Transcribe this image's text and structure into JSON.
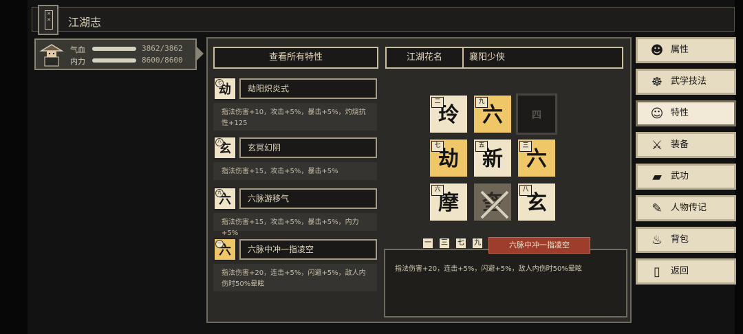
{
  "window": {
    "title": "江湖志"
  },
  "character": {
    "hp_label": "气血",
    "hp_value": "3862/3862",
    "mp_label": "内力",
    "mp_value": "8600/8600"
  },
  "header": {
    "view_all_label": "查看所有特性",
    "nickname_label": "江湖花名",
    "nickname_value": "襄阳少侠"
  },
  "traits": [
    {
      "char": "劫",
      "tier": "七",
      "name": "劫阳炽炎式",
      "desc": "指法伤害+10，攻击+5%，暴击+5%，灼烧抗性+125"
    },
    {
      "char": "玄",
      "tier": "八",
      "name": "玄冥幻阴",
      "desc": "指法伤害+15，攻击+5%，暴击+5%"
    },
    {
      "char": "六",
      "tier": "九",
      "name": "六脉游移气",
      "desc": "指法伤害+15，攻击+5%，暴击+5%，内力+5%"
    },
    {
      "char": "六",
      "tier": "一",
      "name": "六脉中冲一指凌空",
      "desc": "指法伤害+20，连击+5%，闪避+5%，敌人内伤时50%晕眩"
    }
  ],
  "grid": [
    {
      "char": "玲",
      "num": "二",
      "style": "light"
    },
    {
      "char": "六",
      "num": "九",
      "style": "gold"
    },
    {
      "char": "四",
      "num": "",
      "style": "dark"
    },
    {
      "char": "劫",
      "num": "七",
      "style": "gold"
    },
    {
      "char": "新",
      "num": "五",
      "style": "light"
    },
    {
      "char": "六",
      "num": "三",
      "style": "gold"
    },
    {
      "char": "摩",
      "num": "六",
      "style": "light"
    },
    {
      "char": "奎",
      "num": "",
      "style": "locked"
    },
    {
      "char": "玄",
      "num": "八",
      "style": "light"
    }
  ],
  "combo": {
    "chips": [
      "一",
      "三",
      "七",
      "九"
    ],
    "name": "六脉中冲一指凌空",
    "desc": "指法伤害+20，连击+5%，闪避+5%，敌人内伤时50%晕眩"
  },
  "menu": [
    {
      "label": "属性",
      "icon": "person-icon",
      "glyph": "☻"
    },
    {
      "label": "武学技法",
      "icon": "martial-arts-icon",
      "glyph": "☸"
    },
    {
      "label": "特性",
      "icon": "trait-icon",
      "glyph": "☺"
    },
    {
      "label": "装备",
      "icon": "sword-icon",
      "glyph": "⚔"
    },
    {
      "label": "武功",
      "icon": "manual-icon",
      "glyph": "▰"
    },
    {
      "label": "人物传记",
      "icon": "biography-icon",
      "glyph": "✎"
    },
    {
      "label": "背包",
      "icon": "bag-icon",
      "glyph": "♨"
    },
    {
      "label": "返回",
      "icon": "exit-door-icon",
      "glyph": "▯"
    }
  ],
  "colors": {
    "gold_tile": "#f0c766",
    "light_tile": "#efe4c8",
    "accent_red": "#9e3d2c"
  }
}
